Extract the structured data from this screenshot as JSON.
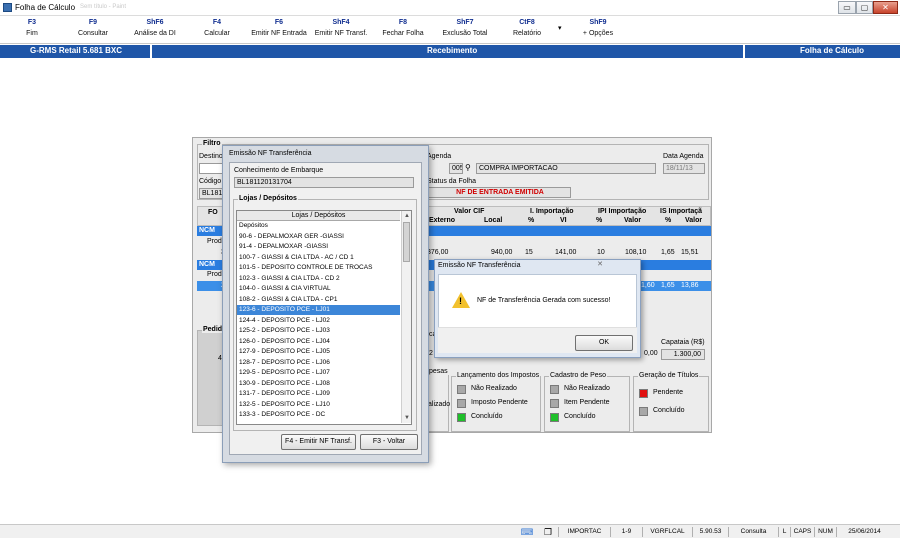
{
  "window": {
    "title": "Folha de Cálculo",
    "ghost_text": "Sem título - Paint",
    "controls": [
      "▭",
      "▢",
      "✕"
    ]
  },
  "toolbar": [
    {
      "key": "F3",
      "label": "Fim"
    },
    {
      "key": "F9",
      "label": "Consultar"
    },
    {
      "key": "ShF6",
      "label": "Análise da DI"
    },
    {
      "key": "F4",
      "label": "Calcular"
    },
    {
      "key": "F6",
      "label": "Emitir NF Entrada"
    },
    {
      "key": "ShF4",
      "label": "Emitir NF Transf."
    },
    {
      "key": "F8",
      "label": "Fechar Folha"
    },
    {
      "key": "ShF7",
      "label": "Exclusão Total"
    },
    {
      "key": "CtF8",
      "label": "Relatório"
    },
    {
      "key": "ShF9",
      "label": "+ Opções"
    }
  ],
  "toolbar_dropdown": "▾",
  "banner": {
    "left": "G-RMS Retail 5.681 BXC",
    "center": "Recebimento",
    "right": "Folha de Cálculo"
  },
  "filter": {
    "legend": "Filtro",
    "destino_label": "Destino",
    "codigo_label": "Código d",
    "codigo_value": "BL1811",
    "agenda_label": "Agenda",
    "agenda_code": "005",
    "agenda_desc": "COMPRA IMPORTACAO",
    "data_agenda_label": "Data Agenda",
    "data_agenda_value": "18/11/13",
    "status_label": "Status da Folha",
    "status_value": "NF DE ENTRADA EMITIDA"
  },
  "grid": {
    "header1": [
      "FO",
      "Valor CIF",
      "I. Importação",
      "IPI Importação",
      "IS Importaçã"
    ],
    "header2": [
      "Externo",
      "Local",
      "%",
      "VI",
      "%",
      "Valor",
      "%",
      "Valor"
    ],
    "row_left": [
      "NCM",
      "Produ",
      "3",
      "NCM",
      "Produ",
      "2"
    ],
    "row1": [
      "376,00",
      "940,00",
      "15",
      "141,00",
      "10",
      "108,10",
      "1,65",
      "15,51"
    ],
    "row2": [
      "1,60",
      "1,65",
      "13,86"
    ]
  },
  "pedidos": {
    "legend": "Pedido",
    "value": "40"
  },
  "capacity": {
    "left_value": "0,00",
    "label": "Capataia (R$)",
    "value": "1.300,00",
    "small_labels": [
      "ca",
      "2"
    ]
  },
  "status_groups": {
    "partial": {
      "legend": "pesas",
      "text": "alizado"
    },
    "impostos": {
      "legend": "Lançamento dos Impostos",
      "items": [
        "Não Realizado",
        "Imposto Pendente",
        "Concluído"
      ]
    },
    "peso": {
      "legend": "Cadastro de Peso",
      "items": [
        "Não Realizado",
        "Item Pendente",
        "Concluído"
      ]
    },
    "titulos": {
      "legend": "Geração de Títulos",
      "items": [
        "Pendente",
        "Concluído"
      ]
    },
    "colors": {
      "grey": "#a8a8a8",
      "green": "#1fbf2a",
      "red": "#e01010"
    }
  },
  "modal": {
    "title": "Emissão NF Transferência",
    "conhecimento_label": "Conhecimento de Embarque",
    "conhecimento_value": "BL181120131704",
    "lojas_legend": "Lojas / Depósitos",
    "list_header": "Lojas / Depósitos",
    "items": [
      "Depósitos",
      "90-6 - DEPALMOXAR GER -GIASSI",
      "91-4 - DEPALMOXAR -GIASSI",
      "100-7 - GIASSI & CIA LTDA - AC / CD 1",
      "101-5 - DEPOSITO CONTROLE DE TROCAS",
      "102-3 - GIASSI & CIA LTDA - CD 2",
      "104-0 - GIASSI & CIA VIRTUAL",
      "108-2 - GIASSI & CIA LTDA - CP1",
      "123-6 - DEPOSITO PCE - LJ01",
      "124-4 - DEPOSITO PCE - LJ02",
      "125-2 - DEPOSITO PCE - LJ03",
      "126-0 - DEPOSITO PCE - LJ04",
      "127-9 - DEPOSITO PCE - LJ05",
      "128-7 - DEPOSITO PCE - LJ06",
      "129-5 - DEPOSITO PCE - LJ07",
      "130-9 - DEPOSITO PCE - LJ08",
      "131-7 - DEPOSITO PCE - LJ09",
      "132-5 - DEPOSITO PCE - LJ10",
      "133-3 - DEPOSITO PCE - DC"
    ],
    "scroll_up": "▲",
    "scroll_down": "▼",
    "emit_button": "F4 - Emitir NF Transf.",
    "back_button": "F3 - Voltar"
  },
  "alert": {
    "title": "Emissão NF Transferência",
    "close": "✕",
    "message": "NF de Transferência Gerada com sucesso!",
    "ok_button": "OK"
  },
  "statusbar": [
    "IMPORTAC",
    "1-9",
    "VGRFLCAL",
    "5.90.53",
    "Consulta",
    "L",
    "CAPS",
    "NUM",
    "25/06/2014"
  ]
}
